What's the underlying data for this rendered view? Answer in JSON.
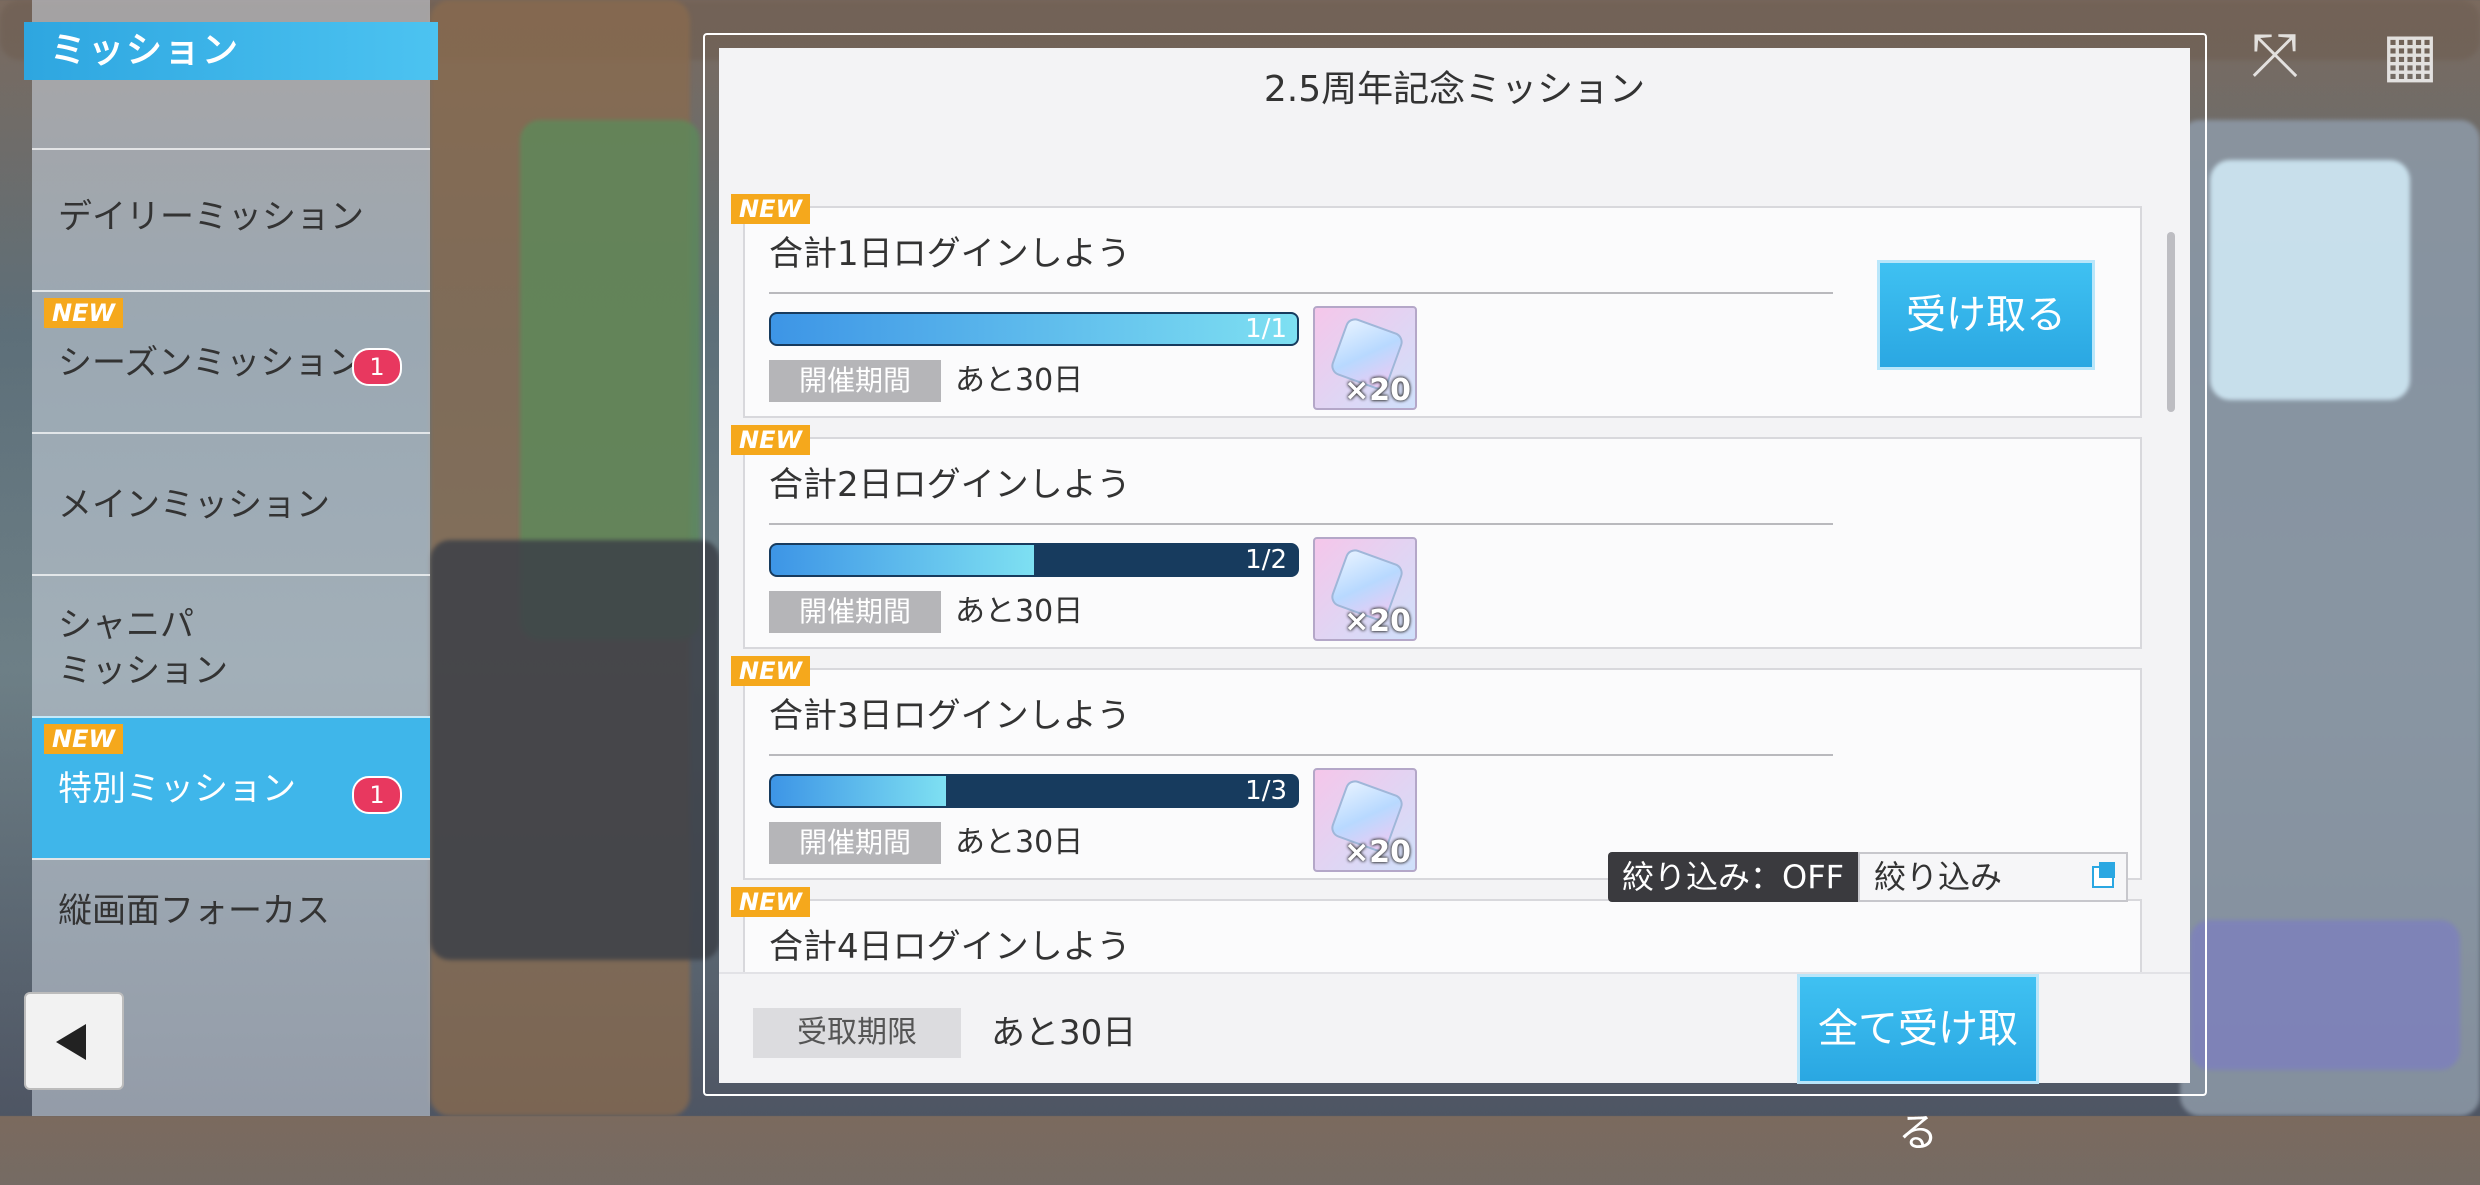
{
  "sidebar": {
    "title": "ミッション",
    "items": [
      {
        "label": "デイリーミッション",
        "new": "",
        "badge": ""
      },
      {
        "label": "シーズンミッション",
        "new": "NEW",
        "badge": "1"
      },
      {
        "label": "メインミッション",
        "new": "",
        "badge": ""
      },
      {
        "label": "シャニパ\nミッション",
        "new": "",
        "badge": ""
      },
      {
        "label": "特別ミッション",
        "new": "NEW",
        "badge": "1"
      },
      {
        "label": "縦画面フォーカス",
        "new": "",
        "badge": ""
      }
    ]
  },
  "panel": {
    "title": "2.5周年記念ミッション",
    "missions": [
      {
        "new": "NEW",
        "title": "合計1日ログインしよう",
        "progress_text": "1/1",
        "progress": 1.0,
        "period_label": "開催期間",
        "period_value": "あと30日",
        "reward_qty": "×20",
        "action": "受け取る"
      },
      {
        "new": "NEW",
        "title": "合計2日ログインしよう",
        "progress_text": "1/2",
        "progress": 0.5,
        "period_label": "開催期間",
        "period_value": "あと30日",
        "reward_qty": "×20"
      },
      {
        "new": "NEW",
        "title": "合計3日ログインしよう",
        "progress_text": "1/3",
        "progress": 0.333,
        "period_label": "開催期間",
        "period_value": "あと30日",
        "reward_qty": "×20"
      },
      {
        "new": "NEW",
        "title": "合計4日ログインしよう"
      }
    ],
    "filter": {
      "state": "絞り込み：OFF",
      "button": "絞り込み"
    },
    "footer": {
      "deadline_label": "受取期限",
      "deadline_value": "あと30日",
      "claim_all": "全て受け取る"
    }
  },
  "colors": {
    "accent": "#2aa7e2",
    "badge": "#e8385f",
    "new_tag": "#f5a81c",
    "progress_track": "#173b5e"
  },
  "icons": [
    "back-arrow-icon",
    "gem-icon",
    "filter-window-icon",
    "fullscreen-icon",
    "grid-menu-icon"
  ]
}
